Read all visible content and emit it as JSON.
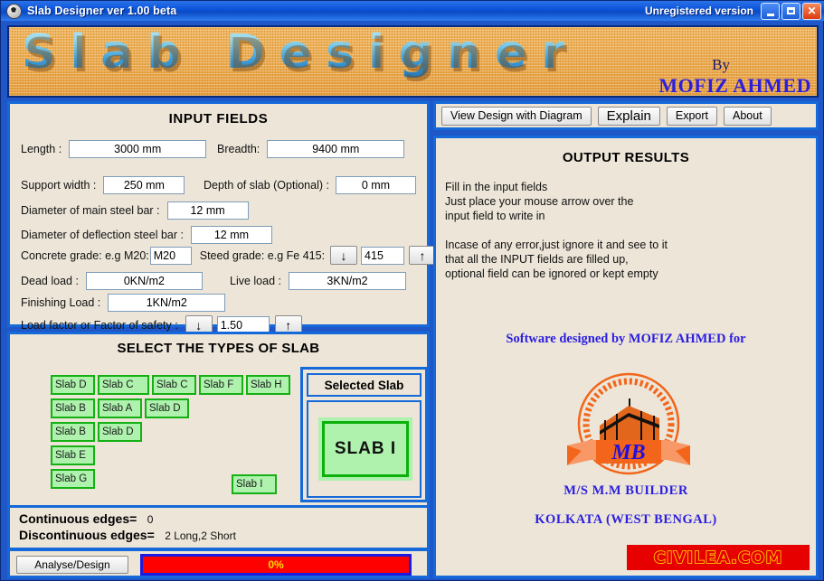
{
  "window": {
    "title": "Slab Designer ver 1.00 beta",
    "unregistered": "Unregistered version",
    "icon": "app-ball-icon",
    "minimize": "–",
    "maximize": "□",
    "close": "✕"
  },
  "banner": {
    "title": "Slab Designer",
    "by": "By",
    "author": "MOFIZ AHMED"
  },
  "input": {
    "title": "INPUT FIELDS",
    "length_label": "Length :",
    "length_value": "3000 mm",
    "breadth_label": "Breadth:",
    "breadth_value": "9400 mm",
    "support_label": "Support width :",
    "support_value": "250 mm",
    "depth_label": "Depth of slab (Optional) :",
    "depth_value": "0 mm",
    "main_bar_label": "Diameter of main steel bar :",
    "main_bar_value": "12 mm",
    "defl_bar_label": "Diameter of deflection steel bar :",
    "defl_bar_value": "12 mm",
    "concrete_label": "Concrete grade: e.g M20:",
    "concrete_value": "M20",
    "steel_label": "Steed grade: e.g Fe 415:",
    "steel_value": "415",
    "dead_label": "Dead load :",
    "dead_value": "0KN/m2",
    "live_label": "Live load :",
    "live_value": "3KN/m2",
    "finishing_label": "Finishing Load :",
    "finishing_value": "1KN/m2",
    "factor_label": "Load factor or Factor of safety :",
    "factor_value": "1.50",
    "spin_down": "↓",
    "spin_up": "↑"
  },
  "types": {
    "title": "SELECT THE TYPES OF SLAB",
    "rows": [
      [
        "Slab D",
        "Slab C",
        "Slab C",
        "Slab F",
        "Slab H"
      ],
      [
        "Slab B",
        "Slab A",
        "Slab D"
      ],
      [
        "Slab B",
        "Slab D"
      ],
      [
        "Slab E"
      ],
      [
        "Slab G"
      ]
    ],
    "slab_i": "Slab I",
    "selected_header": "Selected Slab",
    "selected_value": "SLAB  I"
  },
  "edges": {
    "continuous_label": "Continuous edges=",
    "continuous_value": "0",
    "discontinuous_label": "Discontinuous edges=",
    "discontinuous_value": "2 Long,2 Short"
  },
  "actions": {
    "analyse_label": "Analyse/Design",
    "progress_text": "0%",
    "progress_percent": 0,
    "progress_bar_color": "#ff0000",
    "progress_text_color": "#ffd900"
  },
  "toolbar": {
    "view_design": "View Design with Diagram",
    "explain": "Explain",
    "export": "Export",
    "about": "About"
  },
  "output": {
    "title": "OUTPUT RESULTS",
    "body": "Fill in the input fields\nJust place your mouse arrow over the\ninput field to write in\n\nIncase of any error,just ignore it and see to it\nthat all the INPUT fields are filled up,\noptional field can be ignored or kept empty",
    "credit_line1": "Software designed by MOFIZ AHMED\nfor",
    "company": "M/S M.M BUILDER",
    "city": "KOLKATA (WEST BENGAL)",
    "logo_monogram": "MB",
    "site_badge": "CIVILEA.COM"
  },
  "colors": {
    "window_blue": "#1f56c8",
    "panel_border": "#1569d8",
    "panel_face": "#ece5d8",
    "slab_green": "#aef2ae",
    "slab_green_border": "#14b014",
    "brand_blue": "#2b1ee0",
    "banner_orange": "#eda94a",
    "badge_red": "#e60000",
    "badge_yellow": "#ffe600"
  }
}
